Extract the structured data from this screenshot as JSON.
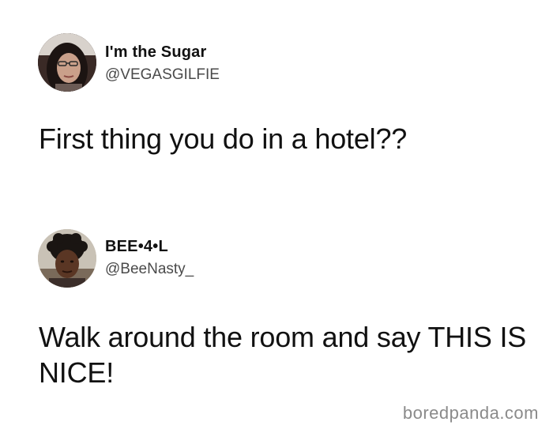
{
  "tweets": [
    {
      "display_name": "I'm the Sugar",
      "handle": "@VEGASGILFIE",
      "text": "First thing you do in a hotel??",
      "avatar_icon": "person-photo-avatar"
    },
    {
      "display_name": "BEE•4•L",
      "handle": "@BeeNasty_",
      "text": "Walk around the room and say THIS IS NICE!",
      "avatar_icon": "person-photo-avatar"
    }
  ],
  "watermark": "boredpanda.com",
  "colors": {
    "background": "#ffffff",
    "text": "#111111",
    "handle": "#4a4a4a",
    "watermark": "#8a8a8a"
  }
}
